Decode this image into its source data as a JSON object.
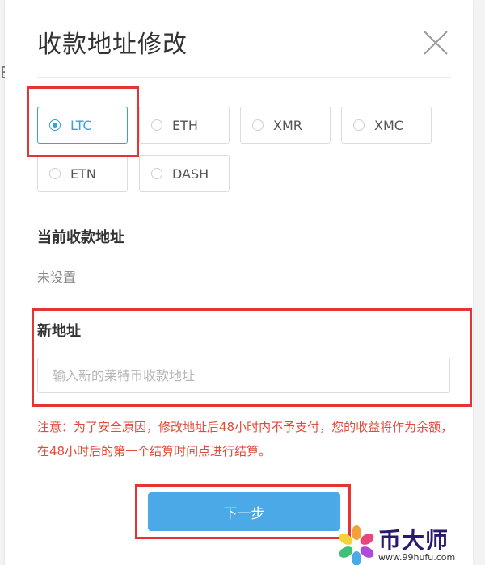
{
  "background_fragment": "E",
  "dialog": {
    "title": "收款地址修改",
    "close_icon": "close-icon"
  },
  "coins": {
    "selected": "LTC",
    "options": [
      {
        "label": "LTC",
        "selected": true
      },
      {
        "label": "ETH",
        "selected": false
      },
      {
        "label": "XMR",
        "selected": false
      },
      {
        "label": "XMC",
        "selected": false
      },
      {
        "label": "ETN",
        "selected": false
      },
      {
        "label": "DASH",
        "selected": false
      }
    ]
  },
  "current_address": {
    "label": "当前收款地址",
    "value": "未设置"
  },
  "new_address": {
    "label": "新地址",
    "placeholder": "输入新的莱特币收款地址",
    "value": ""
  },
  "notice": "注意：为了安全原因，修改地址后48小时内不予支付，您的收益将作为余额，在48小时后的第一个结算时间点进行结算。",
  "next_button": "下一步",
  "watermark": {
    "name": "币大师",
    "url": "www.99hufu.com"
  },
  "colors": {
    "accent": "#3a9fdb",
    "button": "#4aa9e6",
    "highlight": "#e53434",
    "notice": "#e24a3a"
  }
}
